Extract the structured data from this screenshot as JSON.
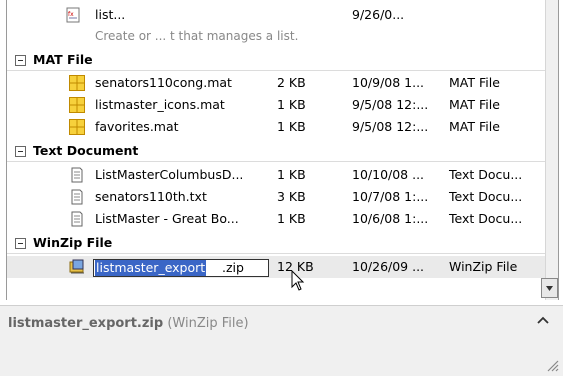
{
  "top_item": {
    "name": "list...",
    "date": "9/26/0...",
    "description": "Create or ... t that manages a list."
  },
  "groups": [
    {
      "title": "MAT File",
      "items": [
        {
          "name": "senators110cong.mat",
          "size": "2 KB",
          "date": "10/9/08 1...",
          "type": "MAT File"
        },
        {
          "name": "listmaster_icons.mat",
          "size": "1 KB",
          "date": "9/5/08 12:...",
          "type": "MAT File"
        },
        {
          "name": "favorites.mat",
          "size": "1 KB",
          "date": "9/5/08 12:...",
          "type": "MAT File"
        }
      ]
    },
    {
      "title": "Text Document",
      "items": [
        {
          "name": "ListMasterColumbusD...",
          "size": "1 KB",
          "date": "10/10/08 ...",
          "type": "Text Docu..."
        },
        {
          "name": "senators110th.txt",
          "size": "3 KB",
          "date": "10/7/08 1:...",
          "type": "Text Docu..."
        },
        {
          "name": "ListMaster - Great Bo...",
          "size": "1 KB",
          "date": "10/6/08 1:...",
          "type": "Text Docu..."
        }
      ]
    },
    {
      "title": "WinZip File",
      "items": [
        {
          "name_selected": "listmaster_export",
          "name_ext": ".zip",
          "size": "12 KB",
          "date": "10/26/09 ...",
          "type": "WinZip File"
        }
      ]
    }
  ],
  "details": {
    "filename": "listmaster_export.zip",
    "filetype": "(WinZip File)"
  }
}
